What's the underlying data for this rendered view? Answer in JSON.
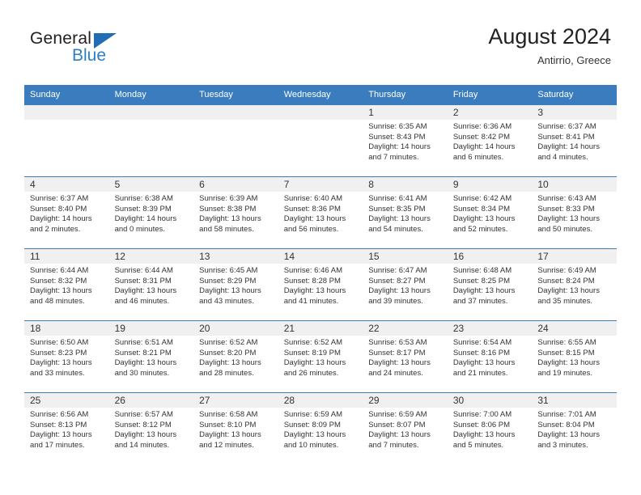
{
  "brand": {
    "name_part1": "General",
    "name_part2": "Blue",
    "triangle_color": "#1f6db5",
    "blue_color": "#2c7fc4"
  },
  "header": {
    "title": "August 2024",
    "subtitle": "Antirrio, Greece"
  },
  "theme": {
    "header_row_bg": "#3a7cbe",
    "header_row_text": "#ffffff",
    "daynum_bg": "#f0f0f0",
    "cell_bg": "#ffffff",
    "border_color": "#3a7cbe",
    "text_color": "#333333"
  },
  "weekdays": [
    "Sunday",
    "Monday",
    "Tuesday",
    "Wednesday",
    "Thursday",
    "Friday",
    "Saturday"
  ],
  "labels": {
    "sunrise": "Sunrise:",
    "sunset": "Sunset:",
    "daylight": "Daylight:"
  },
  "weeks": [
    [
      {
        "day": "",
        "empty": true
      },
      {
        "day": "",
        "empty": true
      },
      {
        "day": "",
        "empty": true
      },
      {
        "day": "",
        "empty": true
      },
      {
        "day": "1",
        "sunrise": "Sunrise: 6:35 AM",
        "sunset": "Sunset: 8:43 PM",
        "daylight": "Daylight: 14 hours and 7 minutes."
      },
      {
        "day": "2",
        "sunrise": "Sunrise: 6:36 AM",
        "sunset": "Sunset: 8:42 PM",
        "daylight": "Daylight: 14 hours and 6 minutes."
      },
      {
        "day": "3",
        "sunrise": "Sunrise: 6:37 AM",
        "sunset": "Sunset: 8:41 PM",
        "daylight": "Daylight: 14 hours and 4 minutes."
      }
    ],
    [
      {
        "day": "4",
        "sunrise": "Sunrise: 6:37 AM",
        "sunset": "Sunset: 8:40 PM",
        "daylight": "Daylight: 14 hours and 2 minutes."
      },
      {
        "day": "5",
        "sunrise": "Sunrise: 6:38 AM",
        "sunset": "Sunset: 8:39 PM",
        "daylight": "Daylight: 14 hours and 0 minutes."
      },
      {
        "day": "6",
        "sunrise": "Sunrise: 6:39 AM",
        "sunset": "Sunset: 8:38 PM",
        "daylight": "Daylight: 13 hours and 58 minutes."
      },
      {
        "day": "7",
        "sunrise": "Sunrise: 6:40 AM",
        "sunset": "Sunset: 8:36 PM",
        "daylight": "Daylight: 13 hours and 56 minutes."
      },
      {
        "day": "8",
        "sunrise": "Sunrise: 6:41 AM",
        "sunset": "Sunset: 8:35 PM",
        "daylight": "Daylight: 13 hours and 54 minutes."
      },
      {
        "day": "9",
        "sunrise": "Sunrise: 6:42 AM",
        "sunset": "Sunset: 8:34 PM",
        "daylight": "Daylight: 13 hours and 52 minutes."
      },
      {
        "day": "10",
        "sunrise": "Sunrise: 6:43 AM",
        "sunset": "Sunset: 8:33 PM",
        "daylight": "Daylight: 13 hours and 50 minutes."
      }
    ],
    [
      {
        "day": "11",
        "sunrise": "Sunrise: 6:44 AM",
        "sunset": "Sunset: 8:32 PM",
        "daylight": "Daylight: 13 hours and 48 minutes."
      },
      {
        "day": "12",
        "sunrise": "Sunrise: 6:44 AM",
        "sunset": "Sunset: 8:31 PM",
        "daylight": "Daylight: 13 hours and 46 minutes."
      },
      {
        "day": "13",
        "sunrise": "Sunrise: 6:45 AM",
        "sunset": "Sunset: 8:29 PM",
        "daylight": "Daylight: 13 hours and 43 minutes."
      },
      {
        "day": "14",
        "sunrise": "Sunrise: 6:46 AM",
        "sunset": "Sunset: 8:28 PM",
        "daylight": "Daylight: 13 hours and 41 minutes."
      },
      {
        "day": "15",
        "sunrise": "Sunrise: 6:47 AM",
        "sunset": "Sunset: 8:27 PM",
        "daylight": "Daylight: 13 hours and 39 minutes."
      },
      {
        "day": "16",
        "sunrise": "Sunrise: 6:48 AM",
        "sunset": "Sunset: 8:25 PM",
        "daylight": "Daylight: 13 hours and 37 minutes."
      },
      {
        "day": "17",
        "sunrise": "Sunrise: 6:49 AM",
        "sunset": "Sunset: 8:24 PM",
        "daylight": "Daylight: 13 hours and 35 minutes."
      }
    ],
    [
      {
        "day": "18",
        "sunrise": "Sunrise: 6:50 AM",
        "sunset": "Sunset: 8:23 PM",
        "daylight": "Daylight: 13 hours and 33 minutes."
      },
      {
        "day": "19",
        "sunrise": "Sunrise: 6:51 AM",
        "sunset": "Sunset: 8:21 PM",
        "daylight": "Daylight: 13 hours and 30 minutes."
      },
      {
        "day": "20",
        "sunrise": "Sunrise: 6:52 AM",
        "sunset": "Sunset: 8:20 PM",
        "daylight": "Daylight: 13 hours and 28 minutes."
      },
      {
        "day": "21",
        "sunrise": "Sunrise: 6:52 AM",
        "sunset": "Sunset: 8:19 PM",
        "daylight": "Daylight: 13 hours and 26 minutes."
      },
      {
        "day": "22",
        "sunrise": "Sunrise: 6:53 AM",
        "sunset": "Sunset: 8:17 PM",
        "daylight": "Daylight: 13 hours and 24 minutes."
      },
      {
        "day": "23",
        "sunrise": "Sunrise: 6:54 AM",
        "sunset": "Sunset: 8:16 PM",
        "daylight": "Daylight: 13 hours and 21 minutes."
      },
      {
        "day": "24",
        "sunrise": "Sunrise: 6:55 AM",
        "sunset": "Sunset: 8:15 PM",
        "daylight": "Daylight: 13 hours and 19 minutes."
      }
    ],
    [
      {
        "day": "25",
        "sunrise": "Sunrise: 6:56 AM",
        "sunset": "Sunset: 8:13 PM",
        "daylight": "Daylight: 13 hours and 17 minutes."
      },
      {
        "day": "26",
        "sunrise": "Sunrise: 6:57 AM",
        "sunset": "Sunset: 8:12 PM",
        "daylight": "Daylight: 13 hours and 14 minutes."
      },
      {
        "day": "27",
        "sunrise": "Sunrise: 6:58 AM",
        "sunset": "Sunset: 8:10 PM",
        "daylight": "Daylight: 13 hours and 12 minutes."
      },
      {
        "day": "28",
        "sunrise": "Sunrise: 6:59 AM",
        "sunset": "Sunset: 8:09 PM",
        "daylight": "Daylight: 13 hours and 10 minutes."
      },
      {
        "day": "29",
        "sunrise": "Sunrise: 6:59 AM",
        "sunset": "Sunset: 8:07 PM",
        "daylight": "Daylight: 13 hours and 7 minutes."
      },
      {
        "day": "30",
        "sunrise": "Sunrise: 7:00 AM",
        "sunset": "Sunset: 8:06 PM",
        "daylight": "Daylight: 13 hours and 5 minutes."
      },
      {
        "day": "31",
        "sunrise": "Sunrise: 7:01 AM",
        "sunset": "Sunset: 8:04 PM",
        "daylight": "Daylight: 13 hours and 3 minutes."
      }
    ]
  ]
}
